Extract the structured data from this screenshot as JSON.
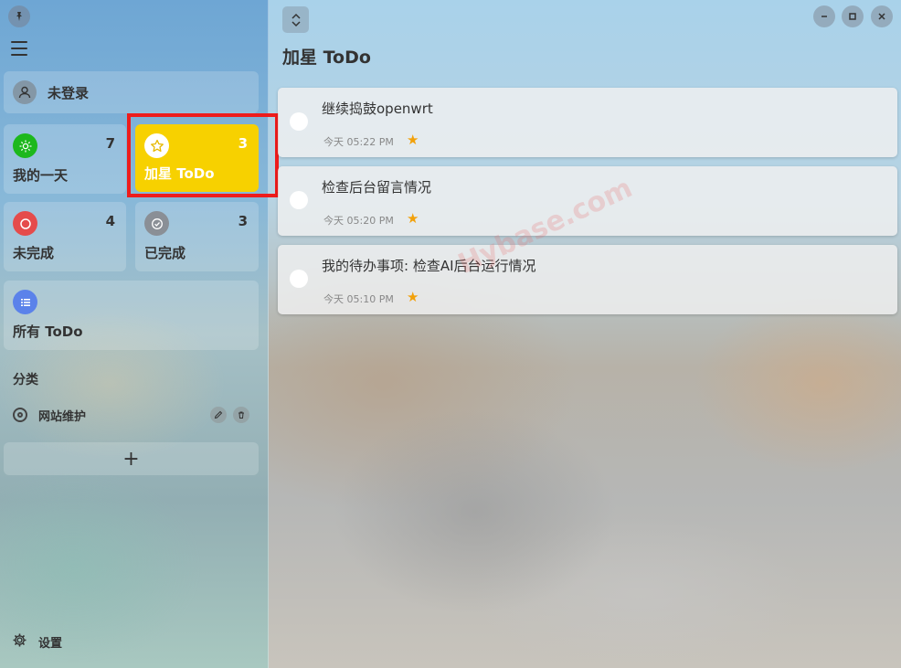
{
  "sidebar": {
    "user": {
      "label": "未登录"
    },
    "tiles": [
      {
        "label": "我的一天",
        "count": "7",
        "color": "#1db81d",
        "icon": "sun-icon"
      },
      {
        "label": "加星 ToDo",
        "count": "3",
        "color": "#f7d100",
        "icon": "star-icon",
        "selected": true
      },
      {
        "label": "未完成",
        "count": "4",
        "color": "#e54b4b",
        "icon": "circle-icon"
      },
      {
        "label": "已完成",
        "count": "3",
        "color": "#8a8f96",
        "icon": "check-circle-icon"
      },
      {
        "label": "所有 ToDo",
        "count": "",
        "color": "#5b82ea",
        "icon": "list-icon"
      }
    ],
    "section_label": "分类",
    "categories": [
      {
        "label": "网站维护",
        "icon": "target-icon"
      }
    ],
    "add_label": "+",
    "settings_label": "设置"
  },
  "main": {
    "title": "加星 ToDo",
    "todos": [
      {
        "title": "继续捣鼓openwrt",
        "time": "今天 05:22 PM",
        "starred": true
      },
      {
        "title": "检查后台留言情况",
        "time": "今天 05:20 PM",
        "starred": true
      },
      {
        "title": "我的待办事项: 检查AI后台运行情况",
        "time": "今天 05:10 PM",
        "starred": true
      }
    ]
  },
  "watermark": "Hybase.com",
  "colors": {
    "starred_tile": "#f7d100",
    "highlight_border": "#ee1c1c",
    "star": "#f2a10a"
  }
}
